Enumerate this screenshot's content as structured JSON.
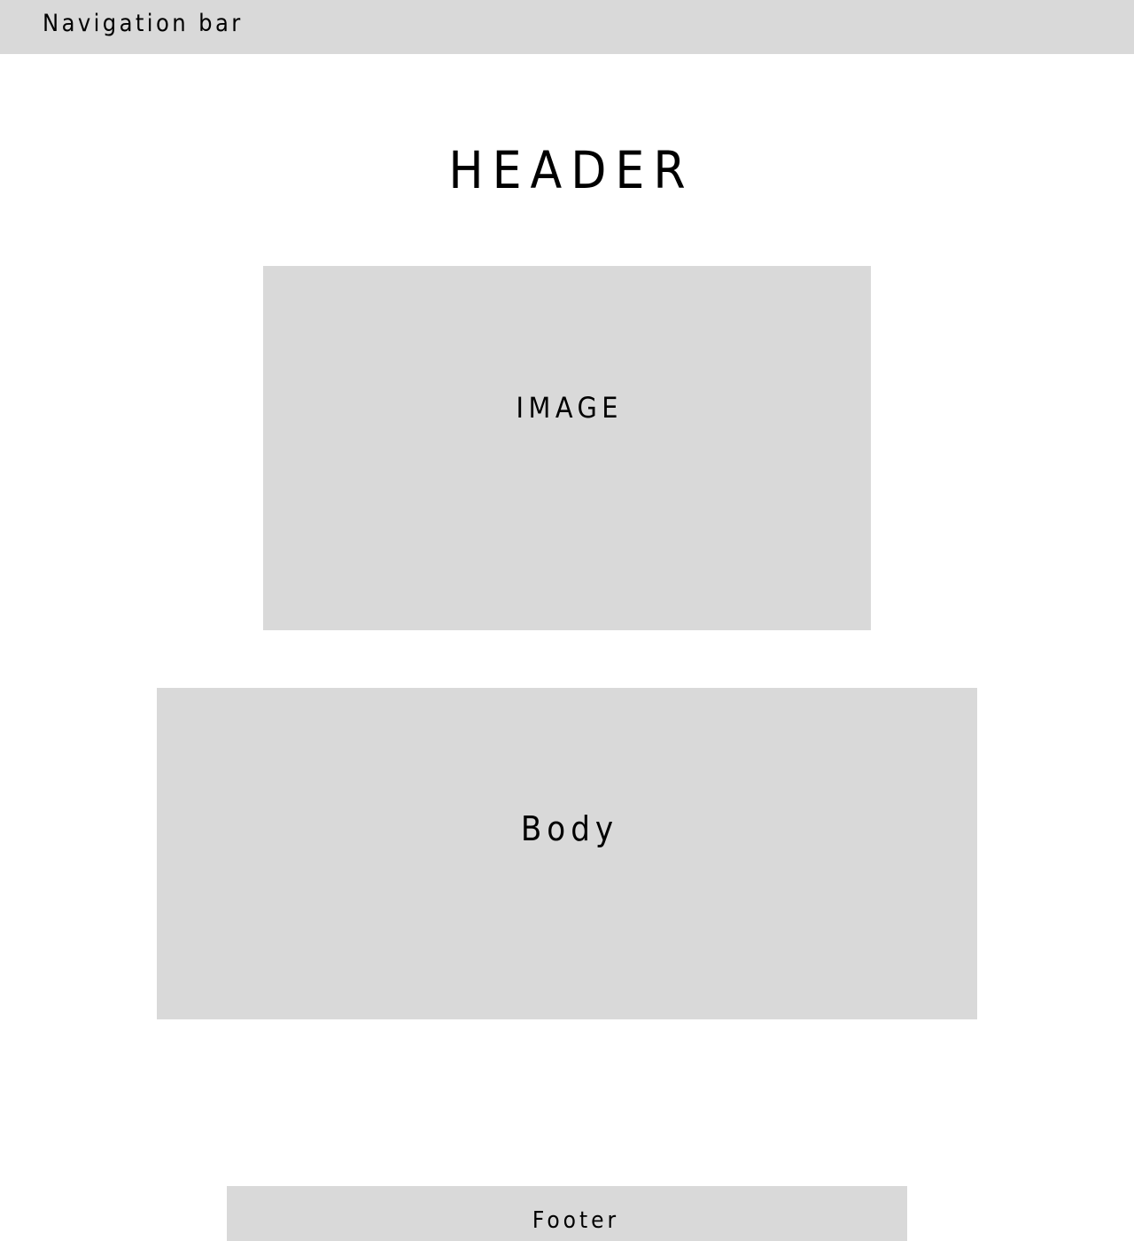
{
  "nav": {
    "label": "Navigation bar"
  },
  "header": {
    "title": "HEADER"
  },
  "image": {
    "label": "IMAGE"
  },
  "body": {
    "label": "Body"
  },
  "footer": {
    "label": "Footer"
  },
  "colors": {
    "placeholder_fill": "#d9d9d9",
    "background": "#ffffff",
    "text": "#000000"
  }
}
